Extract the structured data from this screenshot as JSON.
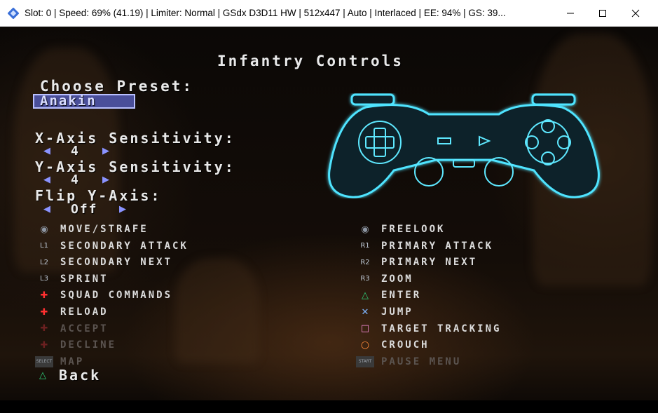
{
  "window": {
    "title": "Slot: 0 | Speed:  69% (41.19) | Limiter: Normal | GSdx D3D11 HW | 512x447 | Auto | Interlaced | EE:  94% | GS:  39...",
    "buttons": {
      "minimize": "—",
      "maximize": "☐",
      "close": "✕"
    }
  },
  "menu": {
    "title": "Infantry Controls",
    "preset_label": "Choose Preset:",
    "preset_value": "Anakin",
    "options": [
      {
        "label": "X-Axis Sensitivity:",
        "value": "4"
      },
      {
        "label": "Y-Axis Sensitivity:",
        "value": "4"
      },
      {
        "label": "Flip Y-Axis:",
        "value": "Off"
      }
    ],
    "left_controls": [
      {
        "icon": "left-stick-icon",
        "glyph": "◉",
        "label": "MOVE/STRAFE",
        "enabled": true
      },
      {
        "icon": "l1-icon",
        "glyph": "L1",
        "label": "SECONDARY ATTACK",
        "enabled": true
      },
      {
        "icon": "l2-icon",
        "glyph": "L2",
        "label": "SECONDARY NEXT",
        "enabled": true
      },
      {
        "icon": "l3-icon",
        "glyph": "L3",
        "label": "SPRINT",
        "enabled": true
      },
      {
        "icon": "dpad-up-icon",
        "glyph": "✚",
        "label": "SQUAD COMMANDS",
        "enabled": true
      },
      {
        "icon": "dpad-down-icon",
        "glyph": "✚",
        "label": "RELOAD",
        "enabled": true
      },
      {
        "icon": "dpad-left-icon",
        "glyph": "✚",
        "label": "ACCEPT",
        "enabled": false
      },
      {
        "icon": "dpad-right-icon",
        "glyph": "✚",
        "label": "DECLINE",
        "enabled": false
      },
      {
        "icon": "select-icon",
        "glyph": "SELECT",
        "label": "MAP",
        "enabled": false
      }
    ],
    "right_controls": [
      {
        "icon": "right-stick-icon",
        "glyph": "◉",
        "label": "FREELOOK",
        "enabled": true
      },
      {
        "icon": "r1-icon",
        "glyph": "R1",
        "label": "PRIMARY ATTACK",
        "enabled": true
      },
      {
        "icon": "r2-icon",
        "glyph": "R2",
        "label": "PRIMARY NEXT",
        "enabled": true
      },
      {
        "icon": "r3-icon",
        "glyph": "R3",
        "label": "ZOOM",
        "enabled": true
      },
      {
        "icon": "triangle-icon",
        "glyph": "△",
        "label": "ENTER",
        "enabled": true
      },
      {
        "icon": "cross-icon",
        "glyph": "✕",
        "label": "JUMP",
        "enabled": true
      },
      {
        "icon": "square-icon",
        "glyph": "□",
        "label": "TARGET TRACKING",
        "enabled": true
      },
      {
        "icon": "circle-icon",
        "glyph": "○",
        "label": "CROUCH",
        "enabled": true
      },
      {
        "icon": "start-icon",
        "glyph": "START",
        "label": "PAUSE MENU",
        "enabled": false
      }
    ],
    "back": {
      "icon": "triangle-icon",
      "glyph": "△",
      "label": "Back"
    }
  },
  "colors": {
    "triangle": "#2fd07a",
    "cross": "#7fb6ff",
    "square": "#ff8fe0",
    "circle": "#ff8a3a",
    "dpad_active": "#ff3030",
    "highlight": "#4a4f9a",
    "controller_glow": "#4fe4ff"
  }
}
